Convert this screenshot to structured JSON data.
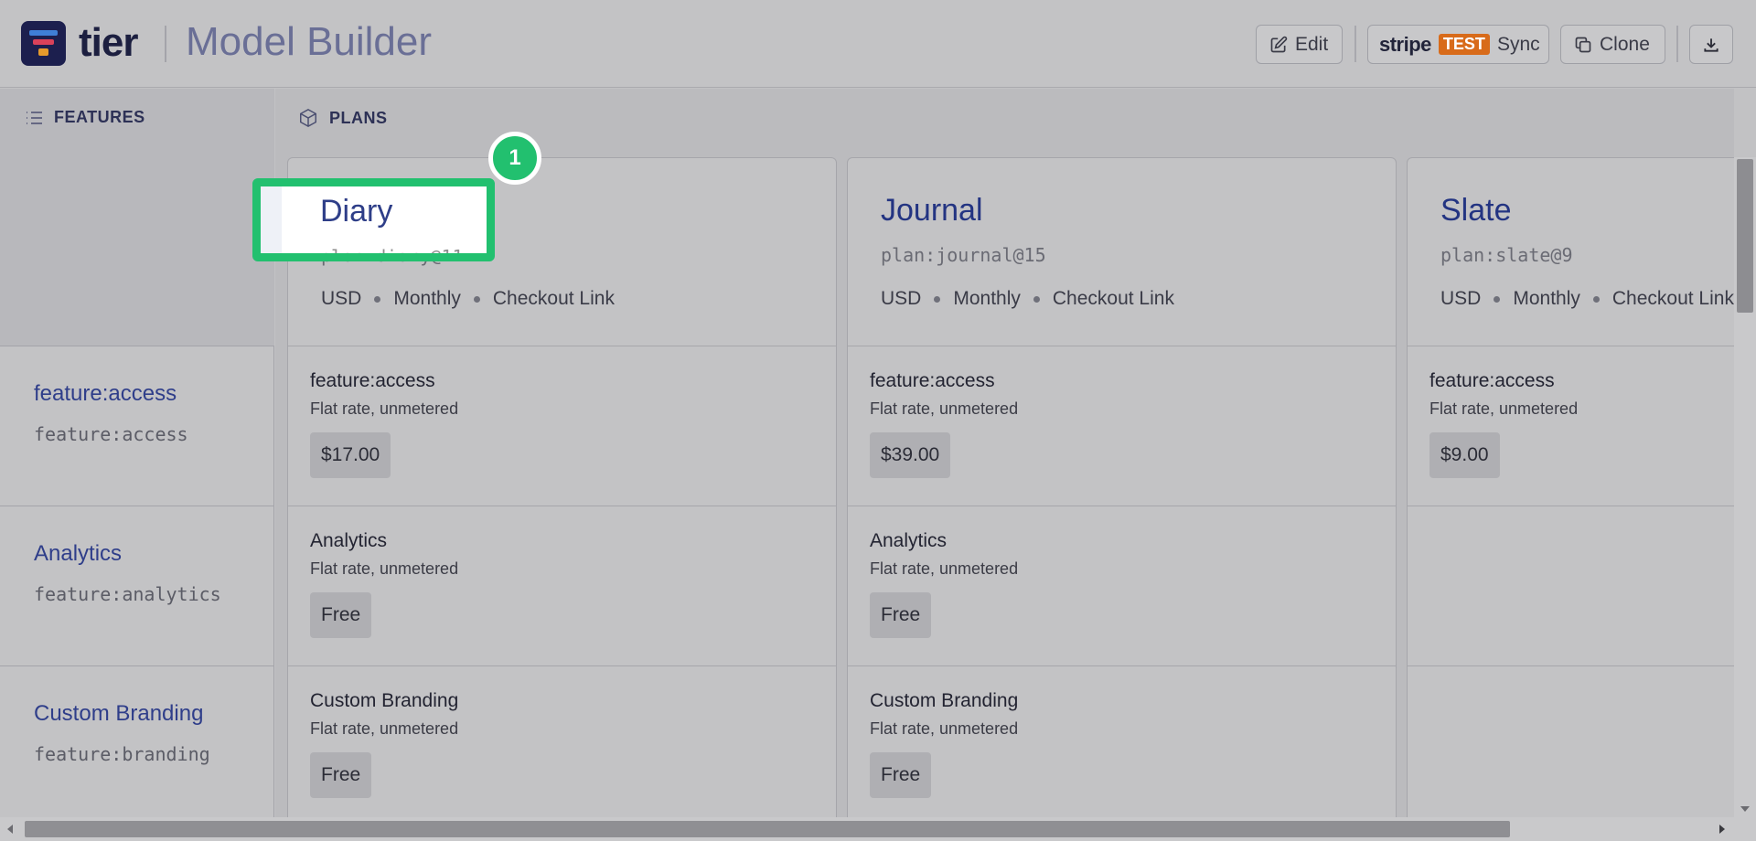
{
  "header": {
    "brand": "tier",
    "title": "Model Builder",
    "edit_label": "Edit",
    "stripe_label": "stripe",
    "test_badge": "TEST",
    "sync_label": "Sync",
    "clone_label": "Clone"
  },
  "features": {
    "heading": "FEATURES",
    "items": [
      {
        "title": "feature:access",
        "key": "feature:access"
      },
      {
        "title": "Analytics",
        "key": "feature:analytics"
      },
      {
        "title": "Custom Branding",
        "key": "feature:branding"
      }
    ]
  },
  "plans": {
    "heading": "PLANS",
    "items": [
      {
        "name": "Diary",
        "id": "plan:diary@11",
        "currency": "USD",
        "interval": "Monthly",
        "link": "Checkout Link",
        "cells": [
          {
            "title": "feature:access",
            "sub": "Flat rate, unmetered",
            "price": "$17.00"
          },
          {
            "title": "Analytics",
            "sub": "Flat rate, unmetered",
            "price": "Free"
          },
          {
            "title": "Custom Branding",
            "sub": "Flat rate, unmetered",
            "price": "Free"
          }
        ]
      },
      {
        "name": "Journal",
        "id": "plan:journal@15",
        "currency": "USD",
        "interval": "Monthly",
        "link": "Checkout Link",
        "cells": [
          {
            "title": "feature:access",
            "sub": "Flat rate, unmetered",
            "price": "$39.00"
          },
          {
            "title": "Analytics",
            "sub": "Flat rate, unmetered",
            "price": "Free"
          },
          {
            "title": "Custom Branding",
            "sub": "Flat rate, unmetered",
            "price": "Free"
          }
        ]
      },
      {
        "name": "Slate",
        "id": "plan:slate@9",
        "currency": "USD",
        "interval": "Monthly",
        "link": "Checkout Link",
        "cells": [
          {
            "title": "feature:access",
            "sub": "Flat rate, unmetered",
            "price": "$9.00"
          }
        ]
      }
    ]
  },
  "highlight": {
    "step_number": "1",
    "color": "#22c06f"
  },
  "icons": {
    "edit": "edit-icon",
    "clone": "copy-icon",
    "download": "download-icon",
    "features": "list-icon",
    "plans": "cube-icon"
  }
}
